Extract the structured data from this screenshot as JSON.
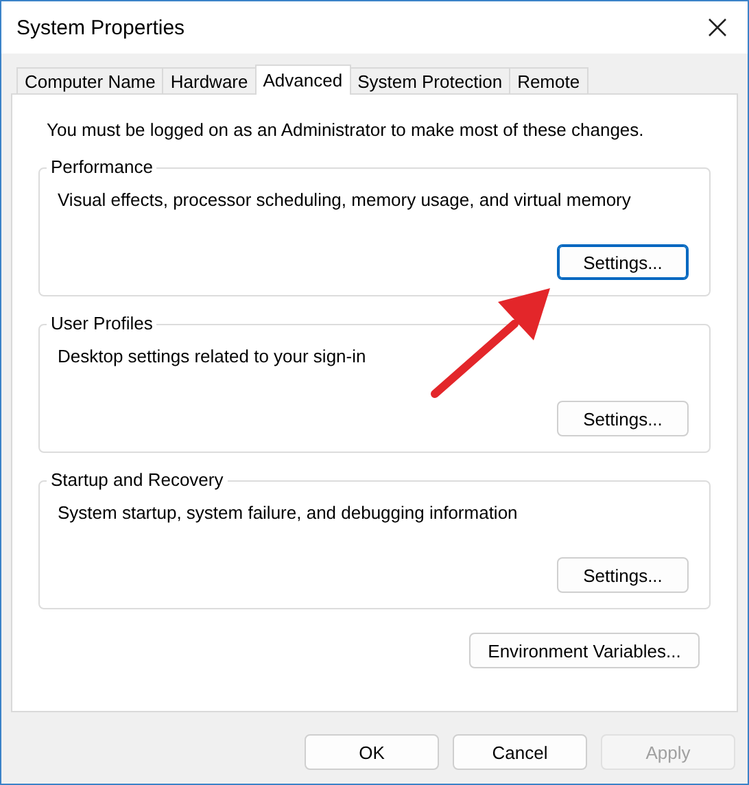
{
  "window": {
    "title": "System Properties"
  },
  "tabs": [
    {
      "label": "Computer Name",
      "selected": false
    },
    {
      "label": "Hardware",
      "selected": false
    },
    {
      "label": "Advanced",
      "selected": true
    },
    {
      "label": "System Protection",
      "selected": false
    },
    {
      "label": "Remote",
      "selected": false
    }
  ],
  "notice": "You must be logged on as an Administrator to make most of these changes.",
  "groups": [
    {
      "title": "Performance",
      "description": "Visual effects, processor scheduling, memory usage, and virtual memory",
      "button": "Settings...",
      "focused": true
    },
    {
      "title": "User Profiles",
      "description": "Desktop settings related to your sign-in",
      "button": "Settings...",
      "focused": false
    },
    {
      "title": "Startup and Recovery",
      "description": "System startup, system failure, and debugging information",
      "button": "Settings...",
      "focused": false
    }
  ],
  "environment_button": "Environment Variables...",
  "buttons": [
    {
      "label": "OK",
      "disabled": false
    },
    {
      "label": "Cancel",
      "disabled": false
    },
    {
      "label": "Apply",
      "disabled": true
    }
  ]
}
